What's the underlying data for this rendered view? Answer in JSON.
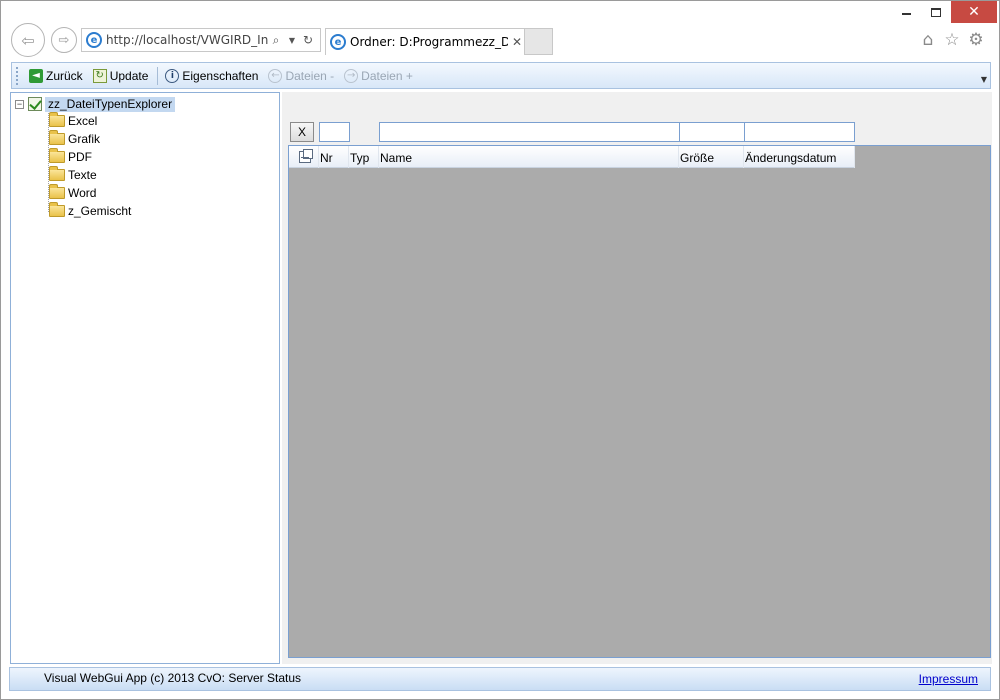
{
  "browser": {
    "address": "http://localhost/VWGIRD_Info/",
    "address_host": "localhost",
    "tab_title": "Ordner: D:Programmezz_Da...",
    "tab_close": "✕",
    "window_close": "✕",
    "icons": [
      "back-arrow-icon",
      "forward-arrow-icon",
      "ie-logo-icon",
      "search-icon",
      "dropdown-icon",
      "refresh-icon",
      "home-icon",
      "favorites-star-icon",
      "settings-gear-icon"
    ]
  },
  "toolbar": {
    "back_label": "Zurück",
    "update_label": "Update",
    "properties_label": "Eigenschaften",
    "files_minus_label": "Dateien -",
    "files_plus_label": "Dateien +"
  },
  "tree": {
    "root_label": "zz_DateiTypenExplorer",
    "items": [
      "Excel",
      "Grafik",
      "PDF",
      "Texte",
      "Word",
      "z_Gemischt"
    ]
  },
  "filter": {
    "clear_label": "X"
  },
  "grid": {
    "columns": [
      "Nr",
      "Typ",
      "Name",
      "Größe",
      "Änderungsdatum"
    ]
  },
  "status": {
    "text": "Visual WebGui App (c) 2013 CvO: Server Status",
    "impressum": "Impressum"
  },
  "colors": {
    "accent_border": "#7a9fd0",
    "grid_background": "#ababab",
    "selection": "#c3d8f0",
    "close_button": "#c74a42"
  }
}
